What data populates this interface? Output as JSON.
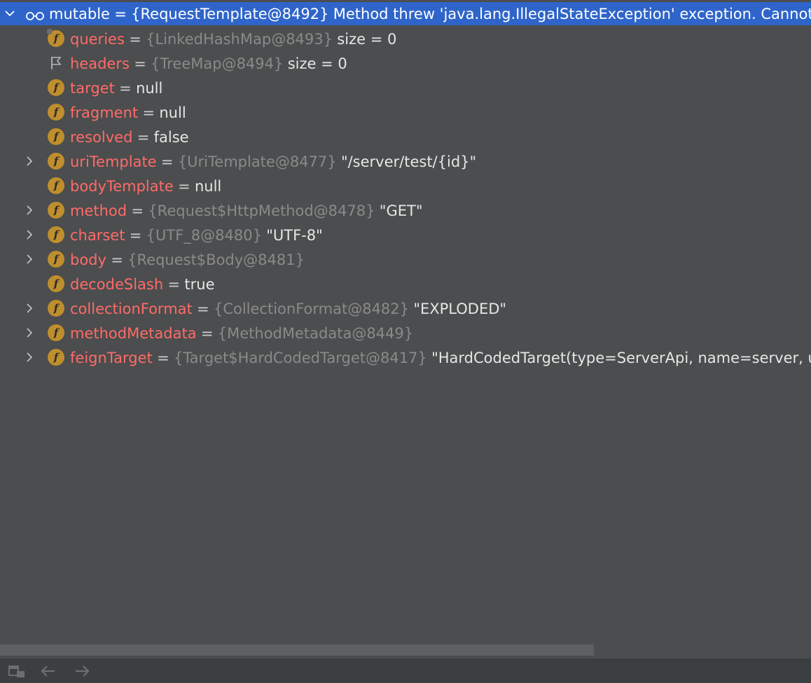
{
  "root": {
    "name": "mutable",
    "ref": "{RequestTemplate@8492}",
    "value": "Method threw 'java.lang.IllegalStateException' exception. Cannot evaluate"
  },
  "fields": [
    {
      "name": "queries",
      "ref": "{LinkedHashMap@8493}",
      "value": " size = 0",
      "icon": "field-locked-icon",
      "expandable": false
    },
    {
      "name": "headers",
      "ref": "{TreeMap@8494}",
      "value": " size = 0",
      "icon": "flag-icon",
      "expandable": false
    },
    {
      "name": "target",
      "ref": "",
      "value": "null",
      "icon": "field-icon",
      "expandable": false
    },
    {
      "name": "fragment",
      "ref": "",
      "value": "null",
      "icon": "field-icon",
      "expandable": false
    },
    {
      "name": "resolved",
      "ref": "",
      "value": "false",
      "icon": "field-icon",
      "expandable": false
    },
    {
      "name": "uriTemplate",
      "ref": "{UriTemplate@8477}",
      "value": "\"/server/test/{id}\"",
      "icon": "field-icon",
      "expandable": true
    },
    {
      "name": "bodyTemplate",
      "ref": "",
      "value": "null",
      "icon": "field-icon",
      "expandable": false
    },
    {
      "name": "method",
      "ref": "{Request$HttpMethod@8478}",
      "value": "\"GET\"",
      "icon": "field-icon",
      "expandable": true
    },
    {
      "name": "charset",
      "ref": "{UTF_8@8480}",
      "value": "\"UTF-8\"",
      "icon": "field-icon",
      "expandable": true
    },
    {
      "name": "body",
      "ref": "{Request$Body@8481}",
      "value": "",
      "icon": "field-icon",
      "expandable": true
    },
    {
      "name": "decodeSlash",
      "ref": "",
      "value": "true",
      "icon": "field-icon",
      "expandable": false
    },
    {
      "name": "collectionFormat",
      "ref": "{CollectionFormat@8482}",
      "value": "\"EXPLODED\"",
      "icon": "field-icon",
      "expandable": true
    },
    {
      "name": "methodMetadata",
      "ref": "{MethodMetadata@8449}",
      "value": "",
      "icon": "field-icon",
      "expandable": true
    },
    {
      "name": "feignTarget",
      "ref": "{Target$HardCodedTarget@8417}",
      "value": "\"HardCodedTarget(type=ServerApi, name=server, url=http://server)\"",
      "icon": "field-icon",
      "expandable": true
    }
  ],
  "badge_letter": "f",
  "colors": {
    "background": "#4b4d4e",
    "selection": "#2f65ca",
    "field_name": "#ff6b68",
    "reference": "#8a8a8a",
    "field_badge": "#bf8e2d"
  },
  "toolbar": {
    "tools": [
      {
        "icon": "restore-layout-icon"
      },
      {
        "icon": "arrow-left-icon"
      },
      {
        "icon": "arrow-right-icon"
      }
    ]
  }
}
